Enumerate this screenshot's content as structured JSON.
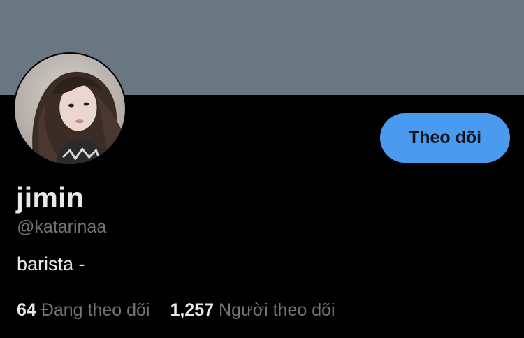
{
  "profile": {
    "banner_color": "#6b7683",
    "display_name": "jimin",
    "handle": "@katarinaa",
    "bio": "barista -",
    "follow_button": {
      "label": "Theo dõi",
      "color": "#4a9bf0"
    },
    "stats": {
      "following": {
        "count": "64",
        "label": "Đang theo dõi"
      },
      "followers": {
        "count": "1,257",
        "label": "Người theo dõi"
      }
    }
  }
}
